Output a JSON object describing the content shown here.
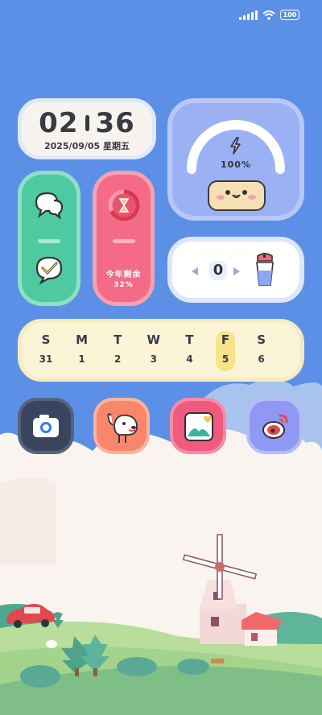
{
  "status_bar": {
    "battery": "100"
  },
  "clock": {
    "hour": "02",
    "minute": "36",
    "date": "2025/09/05 星期五"
  },
  "battery_widget": {
    "percent_label": "100%",
    "level": 1.0
  },
  "year_widget": {
    "label": "今年剩余",
    "value": "32%",
    "remaining": 0.32
  },
  "counter_widget": {
    "count": "0"
  },
  "calendar": {
    "days": [
      {
        "day": "S",
        "date": "31"
      },
      {
        "day": "M",
        "date": "1"
      },
      {
        "day": "T",
        "date": "2"
      },
      {
        "day": "W",
        "date": "3"
      },
      {
        "day": "T",
        "date": "4"
      },
      {
        "day": "F",
        "date": "5"
      },
      {
        "day": "S",
        "date": "6"
      }
    ],
    "highlight_index": 5
  },
  "apps": [
    {
      "icon": "camera-icon",
      "color": "#39455f"
    },
    {
      "icon": "dog-icon",
      "color": "#f7866a"
    },
    {
      "icon": "gallery-icon",
      "color": "#f05a7e"
    },
    {
      "icon": "weibo-icon",
      "color": "#8f98f3"
    }
  ],
  "colors": {
    "wallpaper_sky": "#5b90e6",
    "clouds": "#f9f4ef"
  }
}
